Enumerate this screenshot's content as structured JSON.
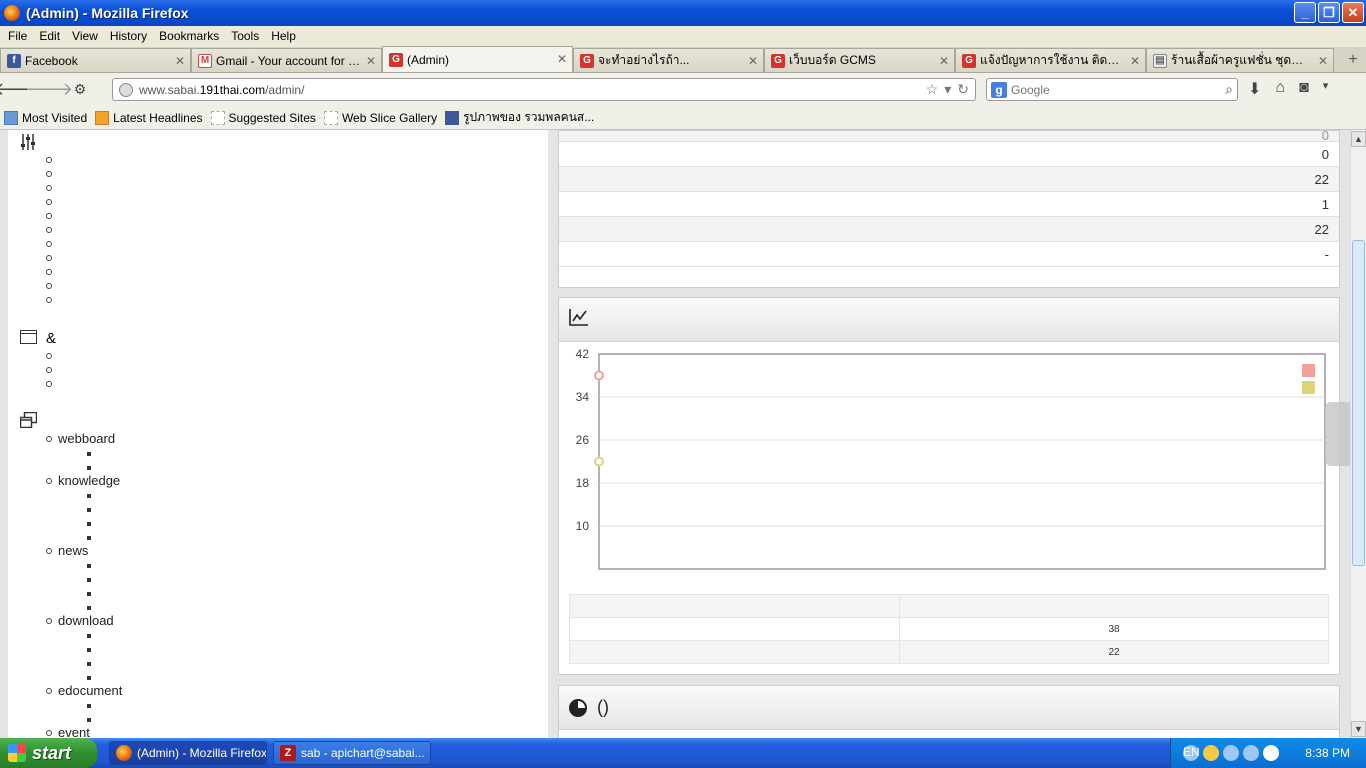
{
  "window": {
    "title": "(Admin) - Mozilla Firefox"
  },
  "menu": [
    "File",
    "Edit",
    "View",
    "History",
    "Bookmarks",
    "Tools",
    "Help"
  ],
  "tabs": [
    {
      "label": "Facebook",
      "icon": "facebook-icon",
      "active": false
    },
    {
      "label": "Gmail - Your account for sab...",
      "icon": "gmail-icon",
      "active": false
    },
    {
      "label": "(Admin)",
      "icon": "gcms-icon",
      "active": true
    },
    {
      "label": "จะทำอย่างไรถ้า...",
      "icon": "gcms-icon",
      "active": false
    },
    {
      "label": "เว็บบอร์ด GCMS",
      "icon": "gcms-icon",
      "active": false
    },
    {
      "label": "แจ้งปัญหาการใช้งาน ติดตั้ง เส...",
      "icon": "gcms-icon",
      "active": false
    },
    {
      "label": "ร้านเสื้อผ้าครูแฟชั่น ชุดทำงาน...",
      "icon": "page-icon",
      "active": false
    }
  ],
  "nav": {
    "url_prefix": "www.sabai.",
    "url_domain": "191thai.com",
    "url_suffix": "/admin/",
    "search_placeholder": "Google"
  },
  "bookmarks": [
    {
      "label": "Most Visited",
      "icon": "most-visited-icon"
    },
    {
      "label": "Latest Headlines",
      "icon": "rss-icon"
    },
    {
      "label": "Suggested Sites",
      "icon": "web-slice-icon"
    },
    {
      "label": "Web Slice Gallery",
      "icon": "web-slice-icon"
    },
    {
      "label": "รูปภาพของ รวมพลคนส...",
      "icon": "facebook-icon"
    }
  ],
  "sidebar": {
    "section2_symbol": "&",
    "modules": [
      "webboard",
      "knowledge",
      "news",
      "download",
      "edocument",
      "event"
    ]
  },
  "stats_table": {
    "values": [
      "0",
      "0",
      "22",
      "1",
      "22",
      "-"
    ]
  },
  "chart_data": {
    "type": "line",
    "title": "",
    "yticks": [
      42,
      34,
      26,
      18,
      10
    ],
    "ylim": [
      2,
      42
    ],
    "x": [
      1
    ],
    "series": [
      {
        "values": [
          38
        ],
        "color": "#f2a29a"
      },
      {
        "values": [
          22
        ],
        "color": "#e0d27a"
      }
    ],
    "legend": "top-right",
    "grid": true
  },
  "chart_table": {
    "rows": [
      [
        "",
        ""
      ],
      [
        "",
        "38"
      ],
      [
        "",
        "22"
      ]
    ]
  },
  "pie_section": {
    "title": "()"
  },
  "taskbar": {
    "start": "start",
    "items": [
      "(Admin) - Mozilla Firefox",
      "sab - apichart@sabai..."
    ],
    "lang": "EN",
    "clock": "8:38 PM"
  }
}
